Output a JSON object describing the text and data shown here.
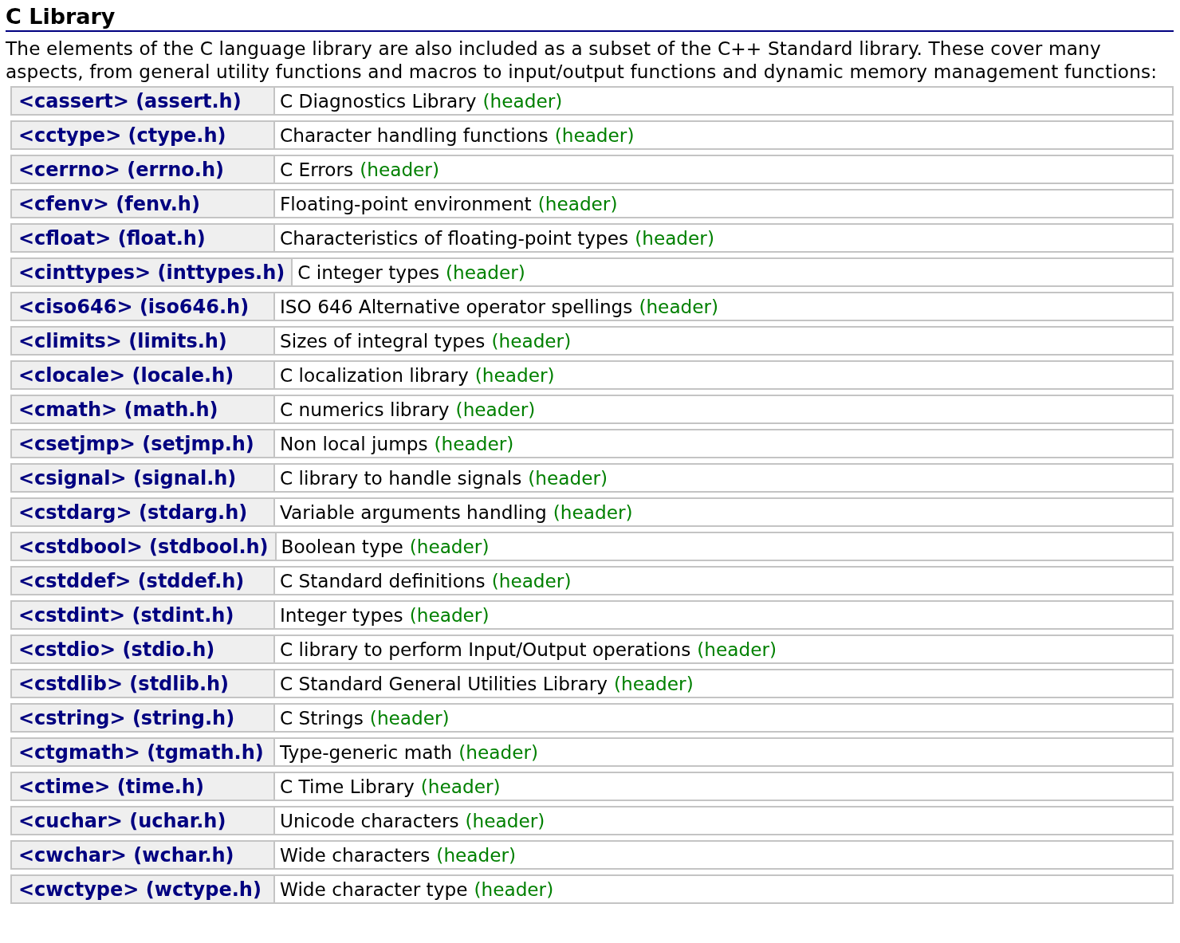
{
  "heading": "C Library",
  "intro": "The elements of the C language library are also included as a subset of the C++ Standard library. These cover many aspects, from general utility functions and macros to input/output functions and dynamic memory management functions:",
  "headers": [
    {
      "name": "<cassert> (assert.h)",
      "description": "C Diagnostics Library",
      "tag": "(header)"
    },
    {
      "name": "<cctype> (ctype.h)",
      "description": "Character handling functions",
      "tag": "(header)"
    },
    {
      "name": "<cerrno> (errno.h)",
      "description": "C Errors",
      "tag": "(header)"
    },
    {
      "name": "<cfenv> (fenv.h)",
      "description": "Floating-point environment",
      "tag": "(header)"
    },
    {
      "name": "<cfloat> (float.h)",
      "description": "Characteristics of floating-point types",
      "tag": "(header)"
    },
    {
      "name": "<cinttypes> (inttypes.h)",
      "description": "C integer types",
      "tag": "(header)"
    },
    {
      "name": "<ciso646> (iso646.h)",
      "description": "ISO 646 Alternative operator spellings",
      "tag": "(header)"
    },
    {
      "name": "<climits> (limits.h)",
      "description": "Sizes of integral types",
      "tag": "(header)"
    },
    {
      "name": "<clocale> (locale.h)",
      "description": "C localization library",
      "tag": "(header)"
    },
    {
      "name": "<cmath> (math.h)",
      "description": "C numerics library",
      "tag": "(header)"
    },
    {
      "name": "<csetjmp> (setjmp.h)",
      "description": "Non local jumps",
      "tag": "(header)"
    },
    {
      "name": "<csignal> (signal.h)",
      "description": "C library to handle signals",
      "tag": "(header)"
    },
    {
      "name": "<cstdarg> (stdarg.h)",
      "description": "Variable arguments handling",
      "tag": "(header)"
    },
    {
      "name": "<cstdbool> (stdbool.h)",
      "description": "Boolean type",
      "tag": "(header)"
    },
    {
      "name": "<cstddef> (stddef.h)",
      "description": "C Standard definitions",
      "tag": "(header)"
    },
    {
      "name": "<cstdint> (stdint.h)",
      "description": "Integer types",
      "tag": "(header)"
    },
    {
      "name": "<cstdio> (stdio.h)",
      "description": "C library to perform Input/Output operations",
      "tag": "(header)"
    },
    {
      "name": "<cstdlib> (stdlib.h)",
      "description": "C Standard General Utilities Library",
      "tag": "(header)"
    },
    {
      "name": "<cstring> (string.h)",
      "description": "C Strings",
      "tag": "(header)"
    },
    {
      "name": "<ctgmath> (tgmath.h)",
      "description": "Type-generic math",
      "tag": "(header)"
    },
    {
      "name": "<ctime> (time.h)",
      "description": "C Time Library",
      "tag": "(header)"
    },
    {
      "name": "<cuchar> (uchar.h)",
      "description": "Unicode characters",
      "tag": "(header)"
    },
    {
      "name": "<cwchar> (wchar.h)",
      "description": "Wide characters",
      "tag": "(header)"
    },
    {
      "name": "<cwctype> (wctype.h)",
      "description": "Wide character type",
      "tag": "(header)"
    }
  ]
}
